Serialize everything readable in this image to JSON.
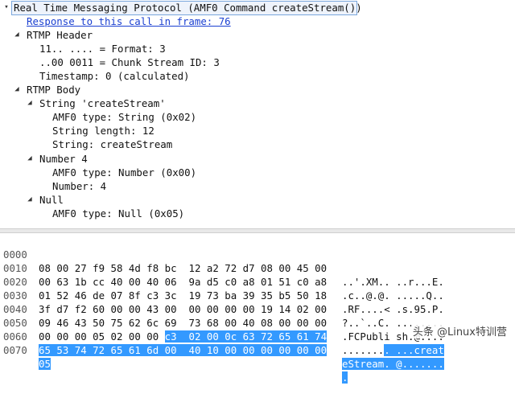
{
  "tree": {
    "root": "Real Time Messaging Protocol (AMF0 Command createStream())",
    "response_link": "Response to this call in frame: 76",
    "rtmp_header": "RTMP Header",
    "format": "11.. .... = Format: 3",
    "chunk_stream": "..00 0011 = Chunk Stream ID: 3",
    "timestamp": "Timestamp: 0 (calculated)",
    "rtmp_body": "RTMP Body",
    "string_node": "String 'createStream'",
    "amf_type_string": "AMF0 type: String (0x02)",
    "string_length": "String length: 12",
    "string_value": "String: createStream",
    "number_node": "Number 4",
    "amf_type_number": "AMF0 type: Number (0x00)",
    "number_value": "Number: 4",
    "null_node": "Null",
    "amf_type_null": "AMF0 type: Null (0x05)"
  },
  "bytes": {
    "rows": [
      {
        "offset": "0000",
        "hex": "08 00 27 f9 58 4d f8 bc  12 a2 72 d7 08 00 45 00",
        "hex_hl": "",
        "ascii": "..'.XM.. ..r...E.",
        "ascii_hl": ""
      },
      {
        "offset": "0010",
        "hex": "00 63 1b cc 40 00 40 06  9a d5 c0 a8 01 51 c0 a8",
        "hex_hl": "",
        "ascii": ".c..@.@. .....Q..",
        "ascii_hl": ""
      },
      {
        "offset": "0020",
        "hex": "01 52 46 de 07 8f c3 3c  19 73 ba 39 35 b5 50 18",
        "hex_hl": "",
        "ascii": ".RF....< .s.95.P.",
        "ascii_hl": ""
      },
      {
        "offset": "0030",
        "hex": "3f d7 f2 60 00 00 43 00  00 00 00 00 19 14 02 00",
        "hex_hl": "",
        "ascii": "?..`..C. ........",
        "ascii_hl": ""
      },
      {
        "offset": "0040",
        "hex": "09 46 43 50 75 62 6c 69  73 68 00 40 08 00 00 00",
        "hex_hl": "",
        "ascii": ".FCPubli sh.@....",
        "ascii_hl": ""
      },
      {
        "offset": "0050",
        "hex": "00 00 00 05 02 00 00 ",
        "hex_hl": "c3  02 00 0c 63 72 65 61 74",
        "ascii": ".......",
        "ascii_hl": ". ...creat"
      },
      {
        "offset": "0060",
        "hex": "",
        "hex_hl": "65 53 74 72 65 61 6d 00  40 10 00 00 00 00 00 00",
        "ascii": "",
        "ascii_hl": "eStream. @......."
      },
      {
        "offset": "0070",
        "hex": "",
        "hex_hl": "05",
        "ascii": "",
        "ascii_hl": "."
      }
    ]
  },
  "watermark": "头条 @Linux特训营",
  "colors": {
    "selection_bg": "#3399ff",
    "link": "#1a3fd1"
  }
}
